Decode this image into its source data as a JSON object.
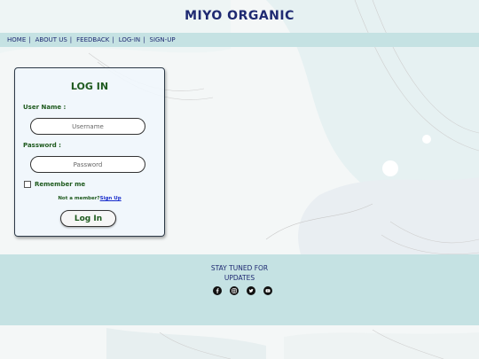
{
  "header": {
    "title": "MIYO ORGANIC"
  },
  "nav": {
    "items": [
      "HOME",
      "ABOUT US",
      "FEEDBACK",
      "LOG-IN",
      "SIGN-UP"
    ],
    "separator": "|"
  },
  "login": {
    "title": "LOG IN",
    "username_label": "User Name :",
    "username_placeholder": "Username",
    "username_value": "",
    "password_label": "Password :",
    "password_placeholder": "Password",
    "password_value": "",
    "remember_label": "Remember me",
    "not_member_text": "Not a member?",
    "signup_link": "Sign Up",
    "button_label": "Log In"
  },
  "footer": {
    "title_line1": "STAY TUNED FOR",
    "title_line2": "UPDATES",
    "social_icons": [
      "facebook-icon",
      "instagram-icon",
      "twitter-icon",
      "youtube-icon"
    ]
  },
  "colors": {
    "brand_navy": "#1f2a72",
    "label_green": "#1e5a1e",
    "bar_teal": "#c5e2e3",
    "link_blue": "#1a2ecc"
  }
}
